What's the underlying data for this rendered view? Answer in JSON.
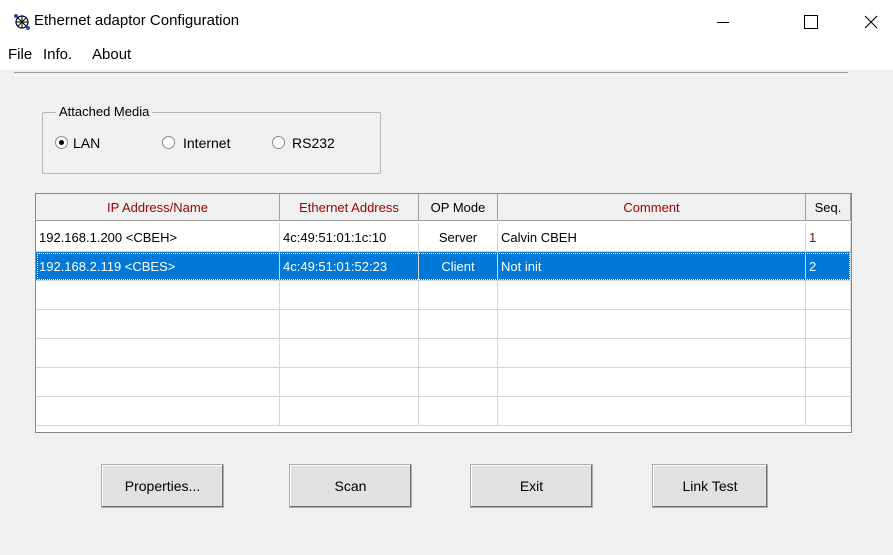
{
  "window": {
    "title": "Ethernet adaptor Configuration"
  },
  "menu": {
    "items": [
      "File",
      "Info.",
      "About"
    ]
  },
  "media": {
    "group_title": "Attached Media",
    "options": [
      {
        "label": "LAN",
        "selected": true
      },
      {
        "label": "Internet",
        "selected": false
      },
      {
        "label": "RS232",
        "selected": false
      }
    ]
  },
  "table": {
    "columns": [
      "IP Address/Name",
      "Ethernet Address",
      "OP Mode",
      "Comment",
      "Seq."
    ],
    "rows": [
      {
        "ip": "192.168.1.200 <CBEH>",
        "mac": "4c:49:51:01:1c:10",
        "mode": "Server",
        "comment": "Calvin CBEH",
        "seq": "1",
        "selected": false
      },
      {
        "ip": "192.168.2.119 <CBES>",
        "mac": "4c:49:51:01:52:23",
        "mode": "Client",
        "comment": "Not init",
        "seq": "2",
        "selected": true
      }
    ],
    "empty_rows": 5
  },
  "buttons": {
    "properties": "Properties...",
    "scan": "Scan",
    "exit": "Exit",
    "link_test": "Link Test"
  },
  "colors": {
    "header_text": "#990000",
    "selection": "#0078d7",
    "seq_text": "#990000"
  }
}
